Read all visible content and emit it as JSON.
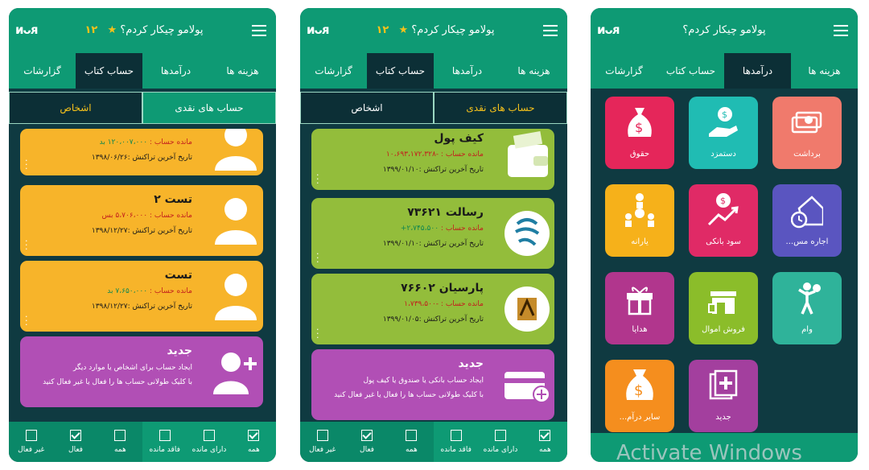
{
  "app": {
    "brand": "ᴎᴗᴙ",
    "title": "پولامو چیکار کردم؟",
    "coin_count": "۱۲",
    "coin_icon": "coin-icon"
  },
  "tabs": [
    "هزینه ها",
    "درآمدها",
    "حساب کتاب",
    "گزارشات"
  ],
  "segments": {
    "cash": "حساب های نقدی",
    "persons": "اشخاص"
  },
  "screen1": {
    "cards": [
      {
        "balance_label": "مانده حساب :",
        "balance": "۱۲۰،۰۰۷،۰۰۰ بد",
        "balance_class": "pos",
        "date": "تاریخ آخرین تراکنش :۱۳۹۸/۰۶/۲۶"
      },
      {
        "title": "تست ۲",
        "balance_label": "مانده حساب :",
        "balance": "۵،۷۰۶،۰۰۰ بس",
        "balance_class": "neg",
        "date": "تاریخ آخرین تراکنش :۱۳۹۸/۱۲/۲۷"
      },
      {
        "title": "تست",
        "balance_label": "مانده حساب :",
        "balance": "۷،۶۵۰،۰۰۰ بد",
        "balance_class": "pos",
        "date": "تاریخ آخرین تراکنش :۱۳۹۸/۱۲/۲۷"
      }
    ],
    "new_card": {
      "title": "جدید",
      "line1": "ایجاد حساب برای اشخاص یا موارد دیگر",
      "line2": "با کلیک طولانی حساب ها را فعال یا غیر فعال کنید"
    },
    "filters": [
      "همه",
      "دارای مانده",
      "فاقد مانده",
      "همه",
      "فعال",
      "غیر فعال"
    ]
  },
  "screen2": {
    "cards": [
      {
        "title": "کیف پول",
        "balance_label": "مانده حساب :",
        "balance": "-۱۰،۶۹۳،۱۷۲،۳۲۸",
        "balance_class": "neg",
        "date": "تاریخ آخرین تراکنش :۱۳۹۹/۰۱/۱۰"
      },
      {
        "title": "رسالت ۷۳۶۲۱",
        "balance_label": "مانده حساب :",
        "balance": "۲،۷۴۵،۵۰۰+",
        "balance_class": "pos",
        "date": "تاریخ آخرین تراکنش :۱۳۹۹/۰۱/۱۰"
      },
      {
        "title": "پارسیان ۷۶۶۰۲",
        "balance_label": "مانده حساب :",
        "balance": "-۱،۷۳۹،۵۰۰",
        "balance_class": "neg",
        "date": "تاریخ آخرین تراکنش :۱۳۹۹/۰۱/۰۵"
      }
    ],
    "new_card": {
      "title": "جدید",
      "line1": "ایجاد حساب بانکی یا صندوق یا کیف پول",
      "line2": "با کلیک طولانی حساب ها را فعال یا غیر فعال کنید"
    },
    "filters": [
      "همه",
      "دارای مانده",
      "فاقد مانده",
      "همه",
      "فعال",
      "غیر فعال"
    ]
  },
  "screen3": {
    "tiles": [
      {
        "label": "برداشت",
        "color": "#f07a6c",
        "icon": "cash-stack-icon"
      },
      {
        "label": "دستمزد",
        "color": "#20bcb3",
        "icon": "hand-money-bag-icon"
      },
      {
        "label": "حقوق",
        "color": "#e5265a",
        "icon": "money-bag-icon"
      },
      {
        "label": "اجاره مس...",
        "color": "#5a55c0",
        "icon": "house-clock-icon"
      },
      {
        "label": "سود بانکی",
        "color": "#e02a66",
        "icon": "growth-icon"
      },
      {
        "label": "یارانه",
        "color": "#f6b11a",
        "icon": "people-money-icon"
      },
      {
        "label": "وام",
        "color": "#2fb39a",
        "icon": "person-loan-icon"
      },
      {
        "label": "فروش اموال",
        "color": "#8bbd2a",
        "icon": "store-icon"
      },
      {
        "label": "هدایا",
        "color": "#b1368d",
        "icon": "gift-icon"
      },
      {
        "label": "جدید",
        "color": "#a33f9e",
        "icon": "add-icon"
      },
      {
        "label": "سایر درآم...",
        "color": "#f58e1e",
        "icon": "big-money-bag-icon"
      }
    ],
    "watermark": "Activate Windows"
  }
}
